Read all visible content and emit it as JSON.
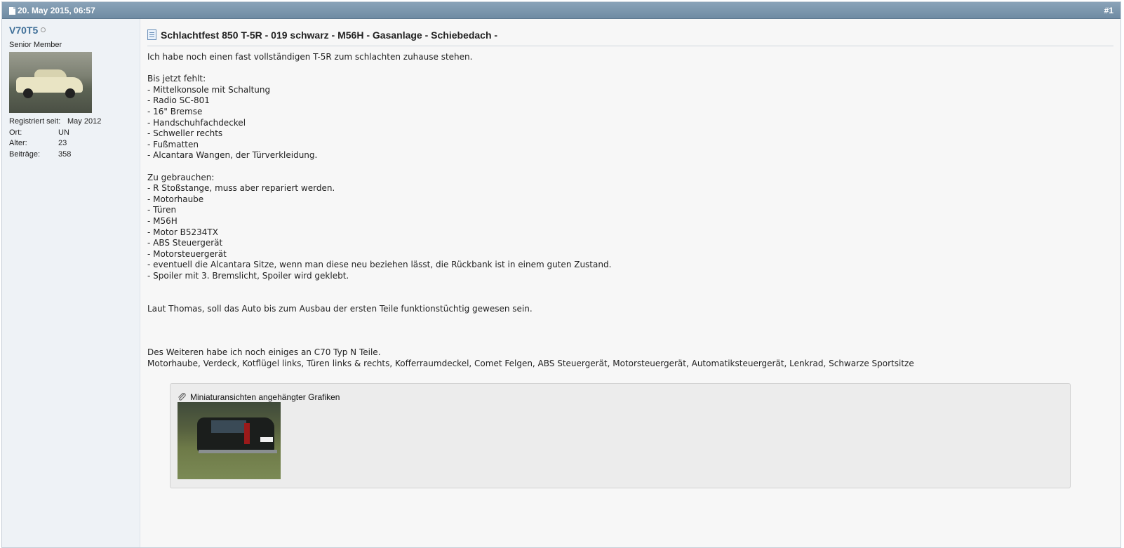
{
  "post": {
    "date": "20. May 2015, 06:57",
    "number": "#1"
  },
  "user": {
    "name": "V70T5",
    "title": "Senior Member",
    "info": [
      {
        "label": "Registriert seit:",
        "value": "May 2012"
      },
      {
        "label": "Ort:",
        "value": "UN"
      },
      {
        "label": "Alter:",
        "value": "23"
      },
      {
        "label": "Beiträge:",
        "value": "358"
      }
    ]
  },
  "content": {
    "title": "Schlachtfest 850 T-5R - 019 schwarz - M56H - Gasanlage - Schiebedach -",
    "lines": [
      "Ich habe noch einen fast vollständigen T-5R zum schlachten zuhause stehen.",
      "",
      "Bis jetzt fehlt:",
      "- Mittelkonsole mit Schaltung",
      "- Radio SC-801",
      "- 16\" Bremse",
      "- Handschuhfachdeckel",
      "- Schweller rechts",
      "- Fußmatten",
      "- Alcantara Wangen, der Türverkleidung.",
      "",
      "Zu gebrauchen:",
      "- R Stoßstange, muss aber repariert werden.",
      "- Motorhaube",
      "- Türen",
      "- M56H",
      "- Motor B5234TX",
      "- ABS Steuergerät",
      "- Motorsteuergerät",
      "- eventuell die Alcantara Sitze, wenn man diese neu beziehen lässt, die Rückbank ist in einem guten Zustand.",
      "- Spoiler mit 3. Bremslicht, Spoiler wird geklebt.",
      "",
      "",
      "Laut Thomas, soll das Auto bis zum Ausbau der ersten Teile funktionstüchtig gewesen sein.",
      "",
      "",
      "",
      "Des Weiteren habe ich noch einiges an C70 Typ N Teile.",
      "Motorhaube, Verdeck, Kotflügel links, Türen links & rechts, Kofferraumdeckel, Comet Felgen, ABS Steuergerät, Motorsteuergerät, Automatiksteuergerät, Lenkrad, Schwarze Sportsitze"
    ]
  },
  "attachments": {
    "heading": "Miniaturansichten angehängter Grafiken"
  },
  "colors": {
    "header_bar": "#7a94ab",
    "username": "#3e6f98",
    "sidebar_bg": "#eef2f6",
    "post_bg": "#f7f7f7",
    "attach_bg": "#ececec"
  }
}
